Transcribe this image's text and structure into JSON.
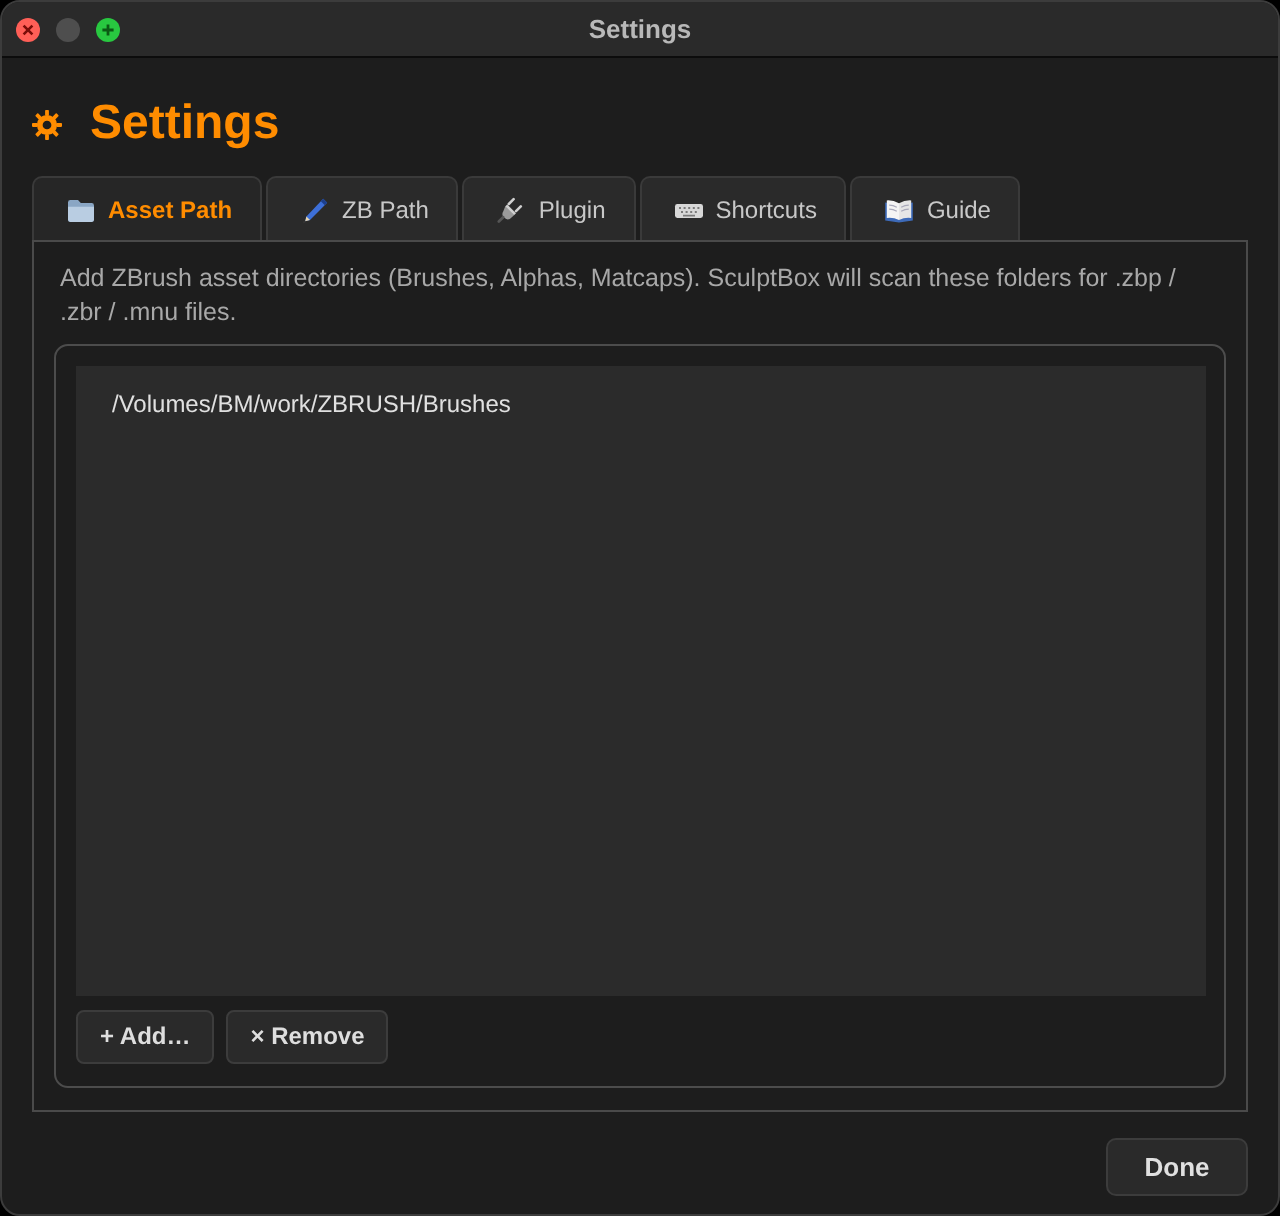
{
  "window": {
    "title": "Settings",
    "controls": [
      {
        "kind": "close",
        "disabled": false
      },
      {
        "kind": "minimize",
        "disabled": true
      },
      {
        "kind": "zoom",
        "disabled": false
      }
    ]
  },
  "header": {
    "title": "Settings"
  },
  "tabs": [
    {
      "label": "Asset Path",
      "selected": true
    },
    {
      "label": "ZB Path",
      "selected": false
    },
    {
      "label": "Plugin",
      "selected": false
    },
    {
      "label": "Shortcuts",
      "selected": false
    },
    {
      "label": "Guide",
      "selected": false
    }
  ],
  "panel": {
    "description": "Add ZBrush asset directories (Brushes, Alphas, Matcaps). SculptBox will scan these folders for .zbp / .zbr / .mnu files.",
    "paths": [
      {
        "text": "/Volumes/BM/work/ZBRUSH/Brushes",
        "selected": false
      }
    ],
    "buttons": [
      "+ Add…",
      "× Remove"
    ]
  },
  "footer": {
    "buttons": [
      "Done"
    ]
  }
}
